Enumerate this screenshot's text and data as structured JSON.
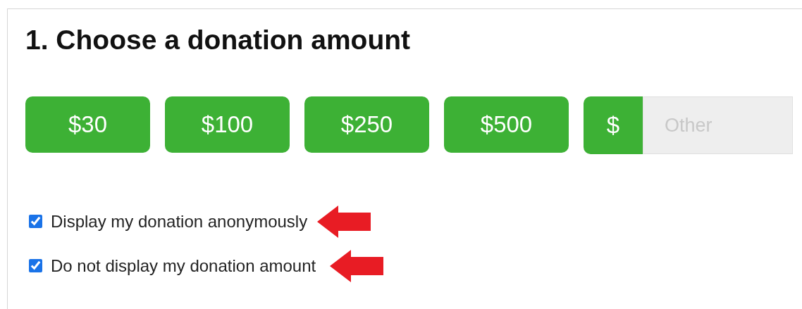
{
  "heading": "1. Choose a donation amount",
  "amounts": [
    "$30",
    "$100",
    "$250",
    "$500"
  ],
  "other": {
    "prefix": "$",
    "placeholder": "Other"
  },
  "options": [
    {
      "label": "Display my donation anonymously",
      "checked": true,
      "annotated": true
    },
    {
      "label": "Do not display my donation amount",
      "checked": true,
      "annotated": true
    }
  ]
}
